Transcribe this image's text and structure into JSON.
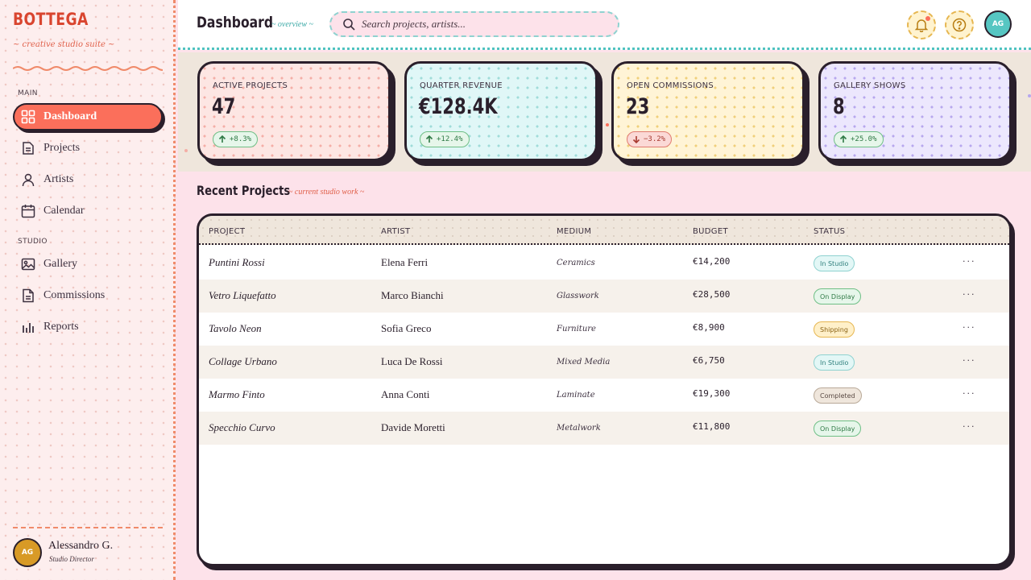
{
  "brand": {
    "name": "BOTTEGA",
    "tagline": "~ creative studio suite ~"
  },
  "sidebar": {
    "sections": [
      {
        "label": "MAIN"
      },
      {
        "label": "STUDIO"
      }
    ],
    "items": [
      {
        "label": "Dashboard",
        "icon": "grid-icon",
        "active": true
      },
      {
        "label": "Projects",
        "icon": "document-icon"
      },
      {
        "label": "Artists",
        "icon": "user-icon"
      },
      {
        "label": "Calendar",
        "icon": "calendar-icon"
      },
      {
        "label": "Gallery",
        "icon": "image-icon"
      },
      {
        "label": "Commissions",
        "icon": "file-icon"
      },
      {
        "label": "Reports",
        "icon": "bar-chart-icon"
      }
    ],
    "user": {
      "initials": "AG",
      "name": "Alessandro G.",
      "role": "Studio Director"
    }
  },
  "header": {
    "title": "Dashboard",
    "subtitle": "~ overview ~",
    "search_placeholder": "Search projects, artists...",
    "avatar_initials": "AG"
  },
  "stats": [
    {
      "label": "ACTIVE PROJECTS",
      "value": "47",
      "delta": "+8.3%",
      "direction": "up",
      "color": "#fde6e3",
      "dot": "#f4aea6"
    },
    {
      "label": "QUARTER REVENUE",
      "value": "€128.4K",
      "delta": "+12.4%",
      "direction": "up",
      "color": "#e0f7f7",
      "dot": "#9fdcd9"
    },
    {
      "label": "OPEN COMMISSIONS",
      "value": "23",
      "delta": "−3.2%",
      "direction": "down",
      "color": "#fff4d6",
      "dot": "#f0cf7a"
    },
    {
      "label": "GALLERY SHOWS",
      "value": "8",
      "delta": "+25.0%",
      "direction": "up",
      "color": "#ece7fd",
      "dot": "#b7a7ee"
    }
  ],
  "projects": {
    "title": "Recent Projects",
    "subtitle": "~ current studio work ~",
    "columns": [
      "PROJECT",
      "ARTIST",
      "MEDIUM",
      "BUDGET",
      "STATUS"
    ],
    "rows": [
      {
        "project": "Puntini Rossi",
        "artist": "Elena Ferri",
        "medium": "Ceramics",
        "budget": "€14,200",
        "status": "In Studio",
        "status_type": "studio"
      },
      {
        "project": "Vetro Liquefatto",
        "artist": "Marco Bianchi",
        "medium": "Glasswork",
        "budget": "€28,500",
        "status": "On Display",
        "status_type": "display"
      },
      {
        "project": "Tavolo Neon",
        "artist": "Sofia Greco",
        "medium": "Furniture",
        "budget": "€8,900",
        "status": "Shipping",
        "status_type": "shipping"
      },
      {
        "project": "Collage Urbano",
        "artist": "Luca De Rossi",
        "medium": "Mixed Media",
        "budget": "€6,750",
        "status": "In Studio",
        "status_type": "studio"
      },
      {
        "project": "Marmo Finto",
        "artist": "Anna Conti",
        "medium": "Laminate",
        "budget": "€19,300",
        "status": "Completed",
        "status_type": "completed"
      },
      {
        "project": "Specchio Curvo",
        "artist": "Davide Moretti",
        "medium": "Metalwork",
        "budget": "€11,800",
        "status": "On Display",
        "status_type": "display"
      }
    ],
    "row_menu": "···"
  }
}
